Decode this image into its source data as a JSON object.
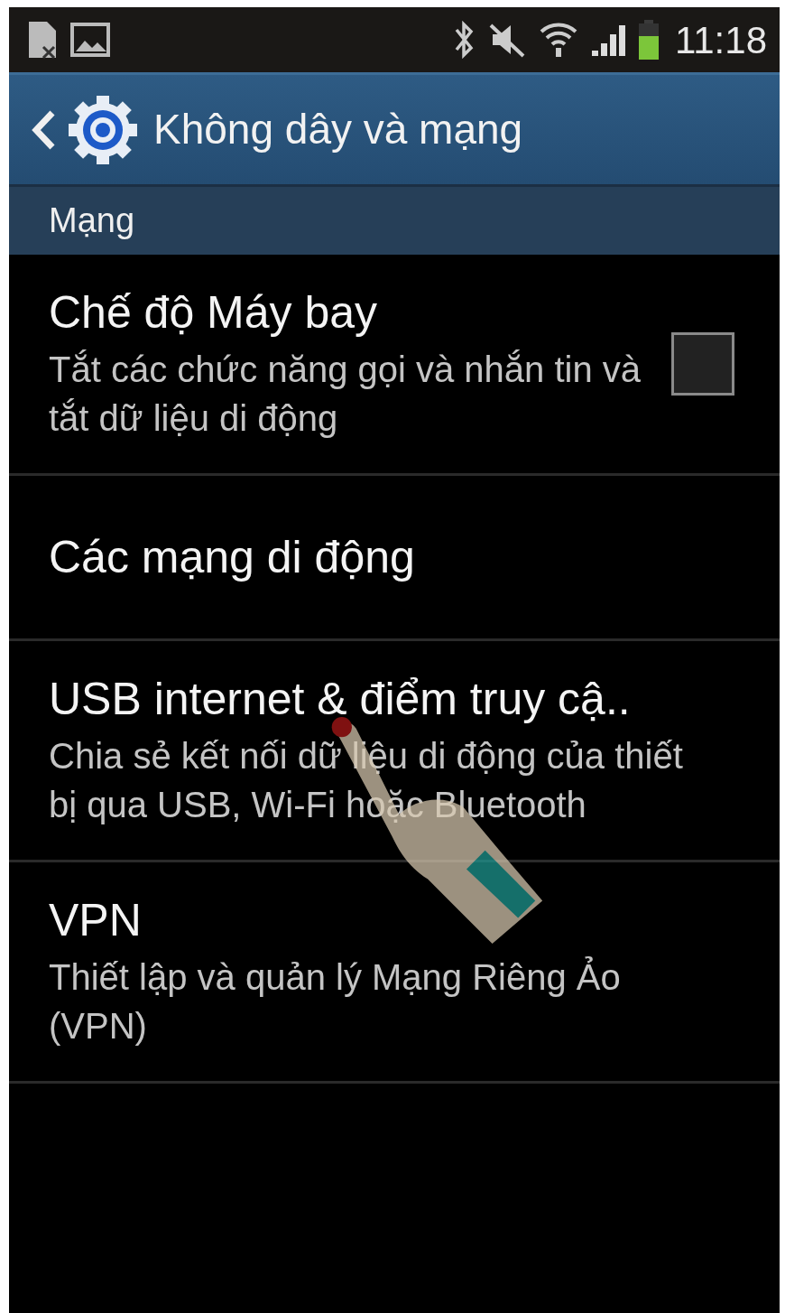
{
  "status_bar": {
    "time": "11:18"
  },
  "header": {
    "title": "Không dây và mạng"
  },
  "section": {
    "title": "Mạng"
  },
  "items": [
    {
      "kind": "checkbox",
      "title": "Chế độ Máy bay",
      "summary": "Tắt các chức năng gọi và nhắn tin và tắt dữ liệu di động",
      "checked": false
    },
    {
      "kind": "plain",
      "title": "Các mạng di động"
    },
    {
      "kind": "plain",
      "title": "USB internet & điểm truy cậ..",
      "summary": "Chia sẻ kết nối dữ liệu di động của thiết bị qua USB, Wi-Fi hoặc Bluetooth"
    },
    {
      "kind": "plain",
      "title": "VPN",
      "summary": "Thiết lập và quản lý Mạng Riêng Ảo (VPN)"
    }
  ]
}
